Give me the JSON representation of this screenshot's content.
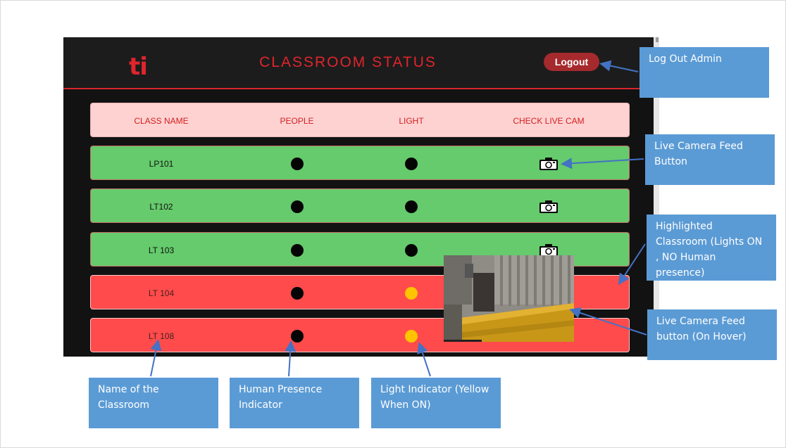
{
  "app": {
    "logo_text": "ti",
    "title": "CLASSROOM STATUS",
    "logout_label": "Logout"
  },
  "table": {
    "headers": [
      "CLASS NAME",
      "PEOPLE",
      "LIGHT",
      "CHECK LIVE CAM"
    ],
    "rows": [
      {
        "name": "LP101",
        "people": false,
        "light": false,
        "camera": true,
        "status": "normal"
      },
      {
        "name": "LT102",
        "people": false,
        "light": false,
        "camera": true,
        "status": "normal"
      },
      {
        "name": "LT 103",
        "people": false,
        "light": false,
        "camera": true,
        "status": "normal"
      },
      {
        "name": "LT 104",
        "people": false,
        "light": true,
        "camera": false,
        "status": "highlighted"
      },
      {
        "name": "LT 108",
        "people": false,
        "light": true,
        "camera": false,
        "status": "highlighted"
      }
    ]
  },
  "annotations": {
    "logout": "Log Out Admin",
    "camera_button": "Live Camera Feed Button",
    "highlighted": "Highlighted Classroom (Lights ON , NO Human presence)",
    "camera_hover": "Live Camera Feed button (On Hover)",
    "class_name": "Name of the Classroom",
    "human_presence": "Human Presence Indicator",
    "light_indicator": "Light Indicator (Yellow When ON)"
  },
  "colors": {
    "accent_red": "#e0252c",
    "row_normal": "#65cb6c",
    "row_highlighted": "#ff4b4b",
    "header_row": "#ffd2d2",
    "light_on": "#ffc400",
    "indicator_off": "#050505",
    "annotation": "#5b9bd5"
  },
  "icons": {
    "camera": "camera-icon",
    "logo": "ti-logo"
  }
}
